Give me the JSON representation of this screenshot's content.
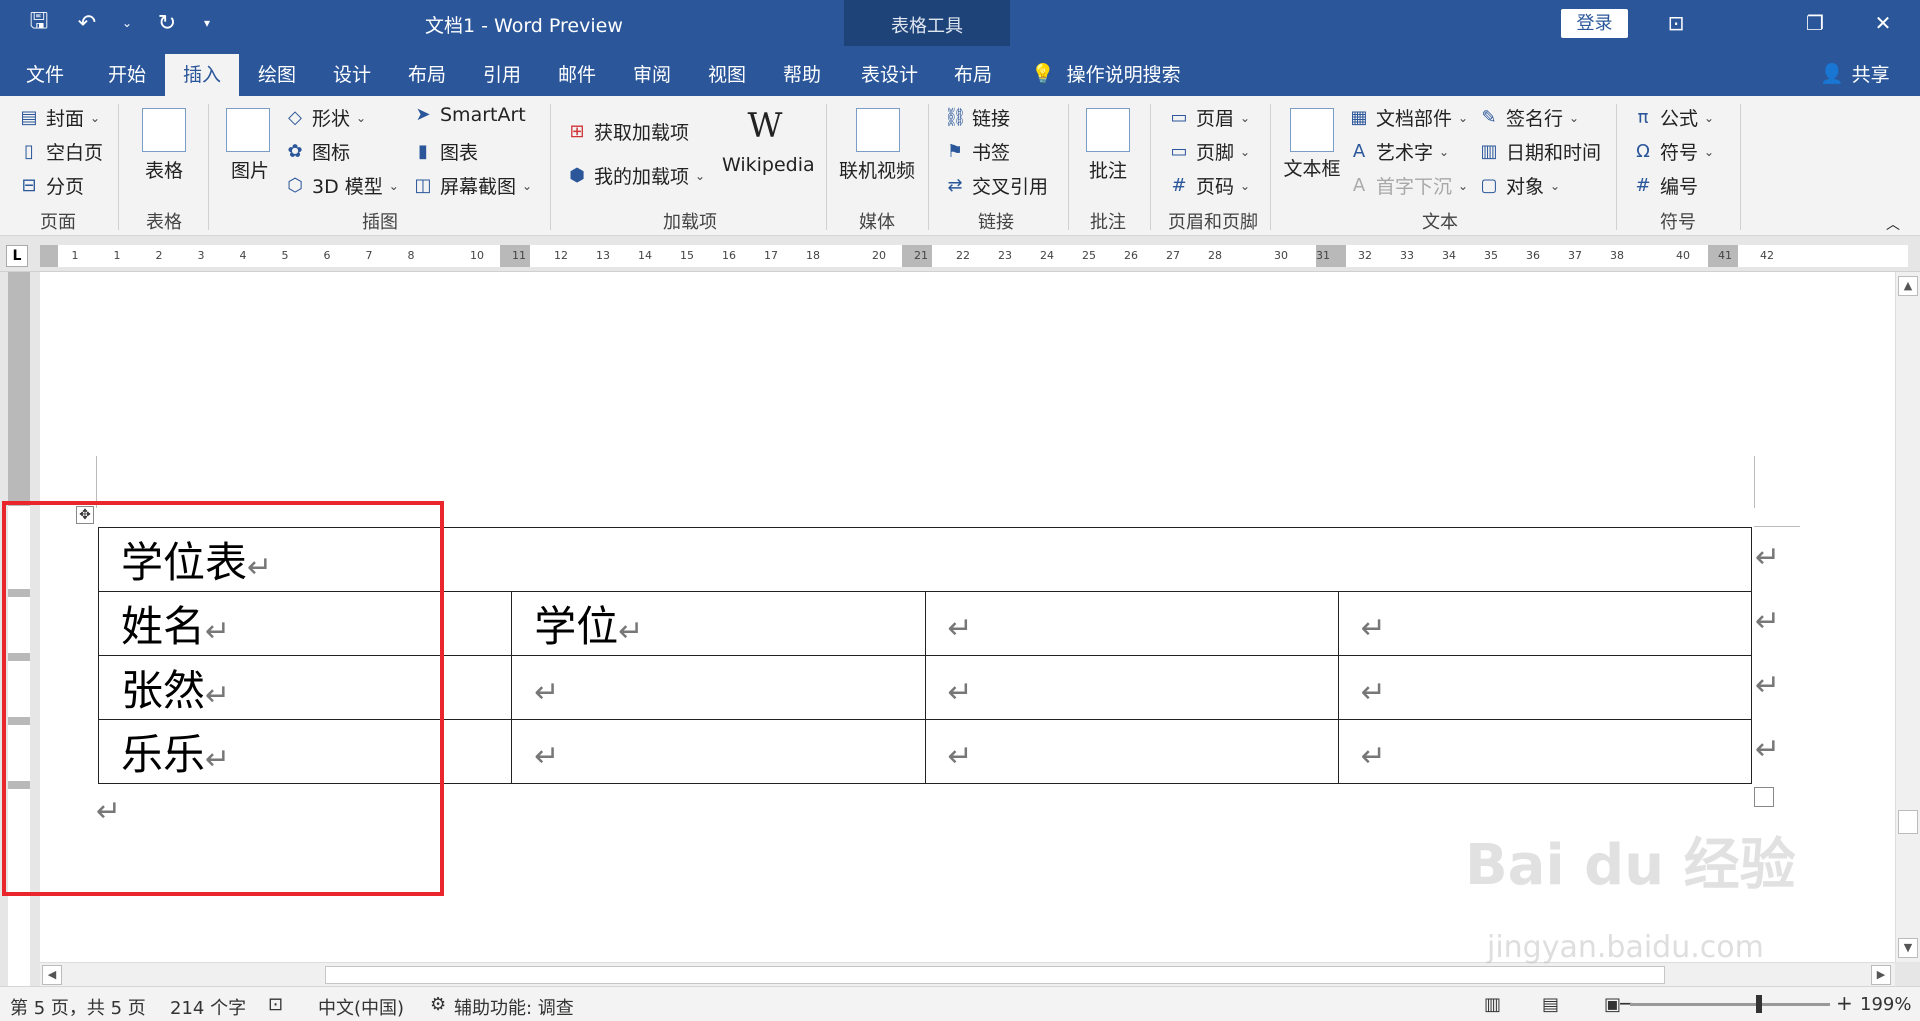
{
  "titlebar": {
    "doc_title": "文档1  -  Word Preview",
    "tools_title": "表格工具",
    "login": "登录"
  },
  "tabs": [
    "文件",
    "开始",
    "插入",
    "绘图",
    "设计",
    "布局",
    "引用",
    "邮件",
    "审阅",
    "视图",
    "帮助",
    "表设计",
    "布局"
  ],
  "active_tab": "插入",
  "tell_me": "操作说明搜索",
  "share": "共享",
  "ribbon": {
    "pages": {
      "cover": "封面",
      "blank": "空白页",
      "break": "分页",
      "group": "页面"
    },
    "tables": {
      "table": "表格",
      "group": "表格"
    },
    "illustrations": {
      "pictures": "图片",
      "shapes": "形状",
      "icons": "图标",
      "model3d": "3D 模型",
      "smartart": "SmartArt",
      "chart": "图表",
      "screenshot": "屏幕截图",
      "group": "插图"
    },
    "addins": {
      "get": "获取加载项",
      "my": "我的加载项",
      "wikipedia": "Wikipedia",
      "group": "加载项"
    },
    "media": {
      "video": "联机视频",
      "group": "媒体"
    },
    "links": {
      "link": "链接",
      "bookmark": "书签",
      "crossref": "交叉引用",
      "group": "链接"
    },
    "comments": {
      "comment": "批注",
      "group": "批注"
    },
    "headerfooter": {
      "header": "页眉",
      "footer": "页脚",
      "pagenum": "页码",
      "group": "页眉和页脚"
    },
    "text": {
      "textbox": "文本框",
      "quickparts": "文档部件",
      "wordart": "艺术字",
      "dropcap": "首字下沉",
      "sigline": "签名行",
      "datetime": "日期和时间",
      "object": "对象",
      "group": "文本"
    },
    "symbols": {
      "equation": "公式",
      "symbol": "符号",
      "number": "编号",
      "group": "符号"
    }
  },
  "ruler": {
    "h_ticks": [
      "1",
      "1",
      "2",
      "3",
      "4",
      "5",
      "6",
      "7",
      "8",
      "10",
      "11",
      "12",
      "13",
      "14",
      "15",
      "16",
      "17",
      "18",
      "20",
      "21",
      "22",
      "23",
      "24",
      "25",
      "26",
      "27",
      "28",
      "30",
      "31",
      "32",
      "33",
      "34",
      "35",
      "36",
      "37",
      "38",
      "40",
      "41",
      "42"
    ]
  },
  "document": {
    "table": {
      "title": "学位表",
      "rows": [
        [
          "姓名",
          "学位",
          "",
          ""
        ],
        [
          "张然",
          "",
          "",
          ""
        ],
        [
          "乐乐",
          "",
          "",
          ""
        ]
      ]
    },
    "para_mark": "↵"
  },
  "status": {
    "page": "第 5 页，共 5 页",
    "words": "214 个字",
    "lang": "中文(中国)",
    "accessibility": "辅助功能: 调查",
    "zoom": "199%"
  },
  "watermark": {
    "main": "Bai du 经验",
    "sub": "jingyan.baidu.com"
  },
  "colors": {
    "brand": "#2b579a",
    "highlight": "#e8262b"
  }
}
